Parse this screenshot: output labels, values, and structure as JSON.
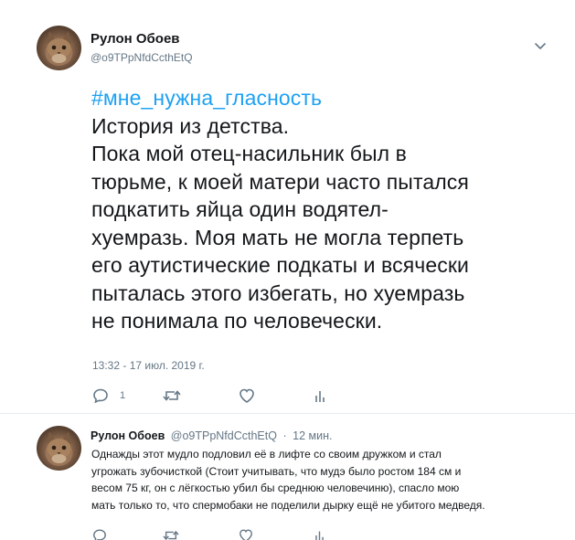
{
  "main_tweet": {
    "display_name": "Рулон Обоев",
    "handle": "@o9TPpNfdCcthEtQ",
    "hashtag": "#мне_нужна_гласность",
    "lines": [
      "История из детства.",
      "Пока мой отец-насильник был в",
      "тюрьме, к моей матери часто пытался",
      "подкатить яйца один водятел-",
      "хуемразь. Моя мать не могла терпеть",
      "его аутистические подкаты и всячески",
      "пыталась этого избегать, но хуемразь",
      "не понимала по человечески."
    ],
    "timestamp": "13:32 - 17 июл. 2019 г.",
    "reply_count": "1"
  },
  "reply_tweet": {
    "display_name": "Рулон Обоев",
    "handle": "@o9TPpNfdCcthEtQ",
    "separator": "·",
    "time": "12 мин.",
    "lines": [
      "Однажды этот мудло подловил её в лифте со своим дружком и стал",
      "угрожать зубочисткой (Стоит учитывать, что мудэ было ростом 184 см и",
      "весом 75 кг, он с лёгкостью убил бы среднюю человечиню), спасло мою",
      "мать только то, что спермобаки не поделили дырку ещё не убитого медведя."
    ]
  },
  "colors": {
    "accent": "#1da1f2",
    "secondary_text": "#657786",
    "primary_text": "#14171a",
    "divider": "#e6ecf0"
  },
  "icons": [
    "avatar-cat",
    "chevron-down-icon",
    "reply-icon",
    "retweet-icon",
    "like-icon",
    "analytics-icon"
  ]
}
